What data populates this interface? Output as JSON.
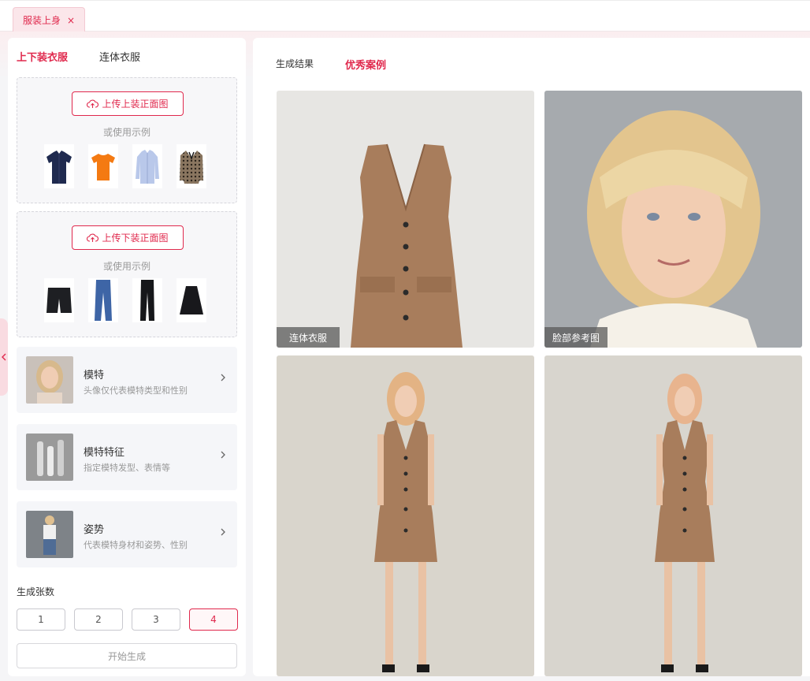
{
  "tab": {
    "label": "服装上身",
    "close": "×"
  },
  "left": {
    "categories": [
      "上下装衣服",
      "连体衣服"
    ],
    "upload_top": {
      "button": "上传上装正面图",
      "hint": "或使用示例"
    },
    "upload_bottom": {
      "button": "上传下装正面图",
      "hint": "或使用示例"
    },
    "options": [
      {
        "title": "模特",
        "desc": "头像仅代表模特类型和性别"
      },
      {
        "title": "模特特征",
        "desc": "指定模特发型、表情等"
      },
      {
        "title": "姿势",
        "desc": "代表模特身材和姿势、性别"
      }
    ],
    "count_label": "生成张数",
    "counts": [
      "1",
      "2",
      "3",
      "4"
    ],
    "selected_count": "4",
    "generate": "开始生成"
  },
  "right": {
    "tabs": [
      "生成结果",
      "优秀案例"
    ],
    "cards": [
      {
        "label": "连体衣服"
      },
      {
        "label": "脸部参考图"
      }
    ]
  },
  "colors": {
    "accent": "#e0294d",
    "dress": "#a87d5c"
  },
  "icons": [
    "cloud-upload-icon",
    "close-icon",
    "chevron-right-icon",
    "chevron-left-icon"
  ]
}
